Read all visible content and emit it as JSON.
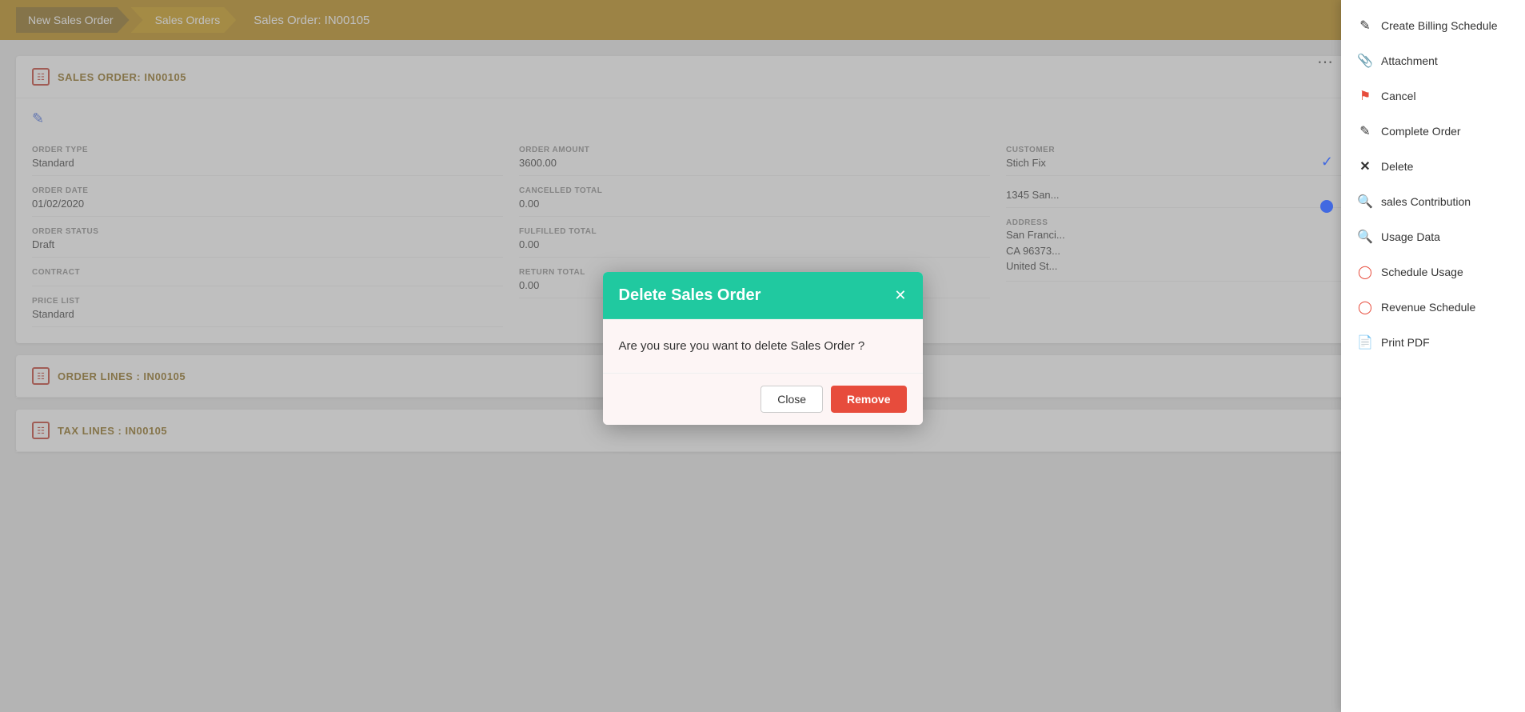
{
  "breadcrumb": {
    "items": [
      {
        "label": "New Sales Order",
        "active": false
      },
      {
        "label": "Sales Orders",
        "active": true
      }
    ],
    "current_page": "Sales Order: IN00105"
  },
  "sales_order": {
    "title": "SALES ORDER: IN00105",
    "fields_left": [
      {
        "label": "ORDER TYPE",
        "value": "Standard"
      },
      {
        "label": "ORDER DATE",
        "value": "01/02/2020"
      },
      {
        "label": "ORDER STATUS",
        "value": "Draft"
      },
      {
        "label": "CONTRACT",
        "value": ""
      },
      {
        "label": "PRICE LIST",
        "value": "Standard"
      }
    ],
    "fields_center": [
      {
        "label": "ORDER AMOUNT",
        "value": "3600.00"
      },
      {
        "label": "CANCELLED TOTAL",
        "value": "0.00"
      },
      {
        "label": "FULFILLED TOTAL",
        "value": "0.00"
      },
      {
        "label": "RETURN TOTAL",
        "value": "0.00"
      }
    ],
    "fields_right": [
      {
        "label": "CUSTOMER",
        "value": "Stich Fix"
      },
      {
        "label": "",
        "value": "1345 San..."
      },
      {
        "label": "ADDRESS",
        "value": "San Franci...\nCA 96373...\nUnited St..."
      }
    ]
  },
  "order_lines": {
    "title": "ORDER LINES : IN00105"
  },
  "tax_lines": {
    "title": "TAX LINES : IN00105"
  },
  "modal": {
    "title": "Delete Sales Order",
    "message": "Are you sure you want to delete Sales Order ?",
    "close_label": "Close",
    "remove_label": "Remove"
  },
  "dropdown": {
    "items": [
      {
        "label": "Create Billing Schedule",
        "icon": "pencil"
      },
      {
        "label": "Attachment",
        "icon": "paperclip"
      },
      {
        "label": "Cancel",
        "icon": "flag"
      },
      {
        "label": "Complete Order",
        "icon": "check-pencil"
      },
      {
        "label": "Delete",
        "icon": "x"
      },
      {
        "label": "sales Contribution",
        "icon": "search"
      },
      {
        "label": "Usage Data",
        "icon": "search"
      },
      {
        "label": "Schedule Usage",
        "icon": "clock"
      },
      {
        "label": "Revenue Schedule",
        "icon": "clock"
      },
      {
        "label": "Print PDF",
        "icon": "print"
      }
    ]
  }
}
